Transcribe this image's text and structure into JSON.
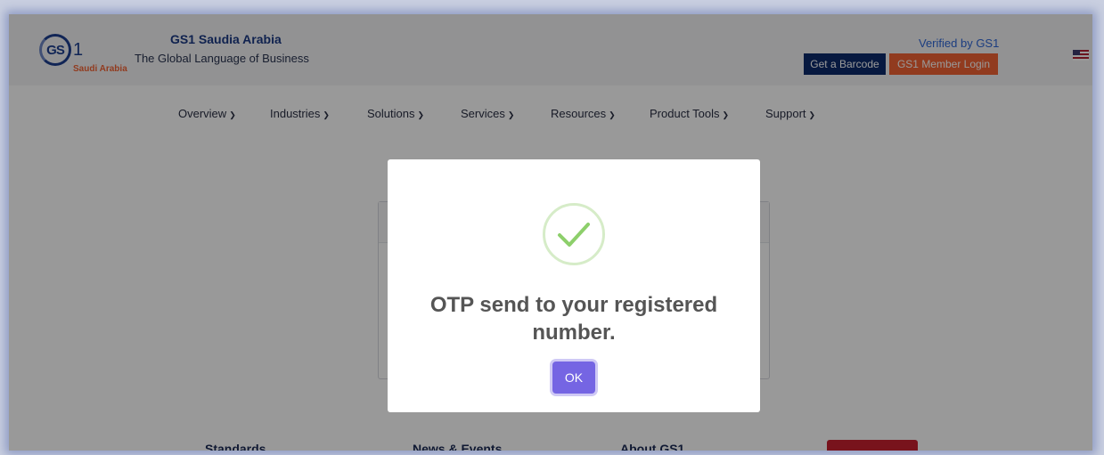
{
  "header": {
    "logo_mark": "GS",
    "logo_one": "1",
    "logo_sub": "Saudi Arabia",
    "brand_title": "GS1 Saudia Arabia",
    "tagline": "The Global Language of Business",
    "verified_link": "Verified by GS1",
    "get_barcode_button": "Get a Barcode",
    "member_login_button": "GS1 Member Login"
  },
  "nav": {
    "items": [
      {
        "label": "Overview"
      },
      {
        "label": "Industries"
      },
      {
        "label": "Solutions"
      },
      {
        "label": "Services"
      },
      {
        "label": "Resources"
      },
      {
        "label": "Product Tools"
      },
      {
        "label": "Support"
      }
    ]
  },
  "footer": {
    "links": [
      "Standards",
      "News & Events",
      "About GS1"
    ]
  },
  "modal": {
    "icon": "checkmark-icon",
    "message": "OTP send to your registered number.",
    "ok_button": "OK"
  },
  "colors": {
    "brand_blue": "#0c2a6b",
    "brand_orange": "#f26334",
    "ok_button": "#7565e3",
    "success_green": "#8dcf6b"
  }
}
